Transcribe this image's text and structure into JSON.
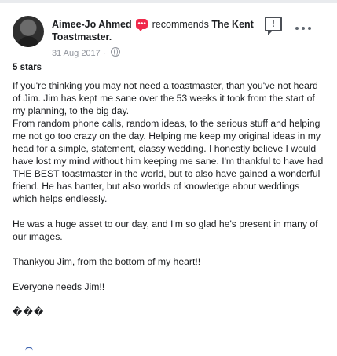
{
  "review": {
    "author": "Aimee-Jo Ahmed",
    "action": "recommends",
    "page_name": "The Kent Toastmaster.",
    "date": "31 Aug 2017",
    "separator": "·",
    "rating": "5 stars",
    "paragraphs": [
      "If you're thinking you may not need a toastmaster, than you've not heard of Jim. Jim has kept me sane over the 53 weeks it took from the start of my planning, to the big day.",
      "From random phone calls, random ideas, to the serious stuff and helping me not go too crazy on the day. Helping me keep my original ideas in my head for a simple, statement, classy wedding. I honestly believe I would have lost my mind without him keeping me sane. I'm thankful to have had THE BEST toastmaster in the world, but to also have gained a wonderful friend. He has banter, but also worlds of knowledge about weddings which helps endlessly.",
      "He was a huge asset to our day, and I'm so glad he's present in many of our images.",
      "Thankyou Jim, from the bottom of my heart!!",
      "Everyone needs Jim!!",
      "���"
    ]
  },
  "icons": {
    "recommend": "speech-bubble-icon",
    "report": "report-icon",
    "more": "more-options-icon",
    "privacy": "globe-icon"
  },
  "colors": {
    "recommend_red": "#f0284a",
    "meta_gray": "#90949c",
    "text": "#1c1e21"
  }
}
